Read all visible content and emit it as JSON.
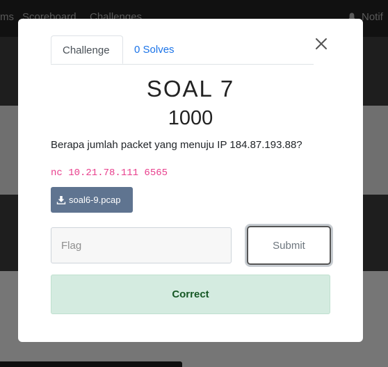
{
  "background": {
    "nav_items": [
      "ms",
      "Scoreboard",
      "Challenges"
    ],
    "nav_right": "Notif"
  },
  "modal": {
    "tabs": [
      {
        "label": "Challenge",
        "active": true
      },
      {
        "label": "0 Solves",
        "active": false
      }
    ],
    "close_icon": "close-icon",
    "challenge_name": "SOAL 7",
    "challenge_value": "1000",
    "description": "Berapa jumlah packet yang menuju IP 184.87.193.88?",
    "command": "nc 10.21.78.111 6565",
    "file": {
      "icon": "download-icon",
      "label": "soal6-9.pcap"
    },
    "flag_input": {
      "placeholder": "Flag",
      "value": ""
    },
    "submit_label": "Submit",
    "result_message": "Correct"
  },
  "colors": {
    "tab_link": "#1a73e8",
    "code_text": "#e83e8c",
    "file_button": "#5f7490",
    "success_bg": "#d4ebe0",
    "success_text": "#155724"
  }
}
